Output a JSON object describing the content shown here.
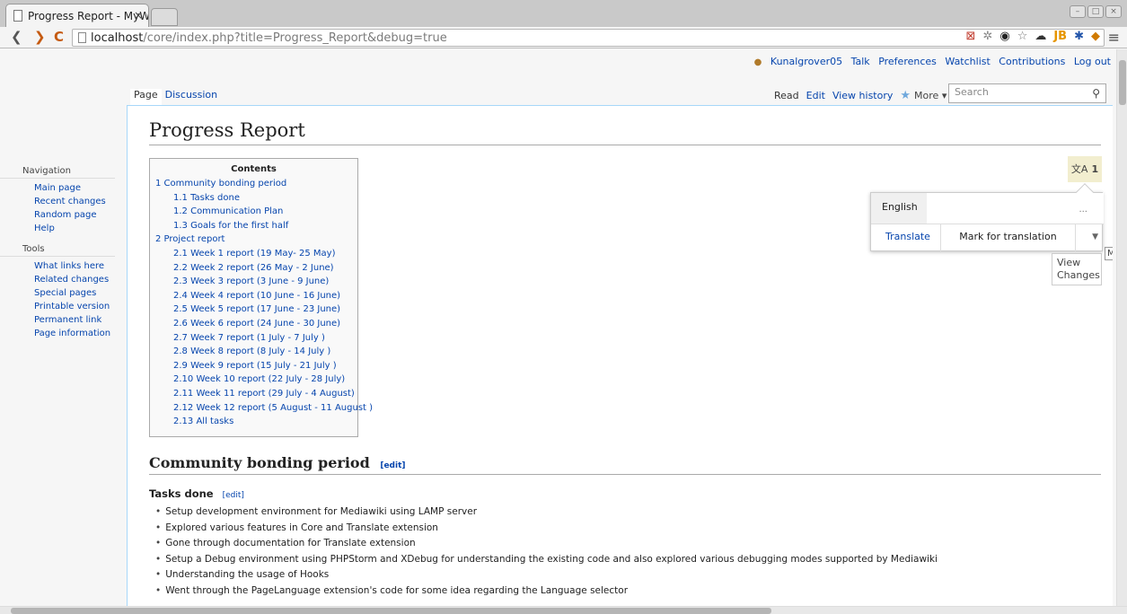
{
  "browser": {
    "tab_title": "Progress Report - MyW",
    "tab_close": "×",
    "url_host": "localhost",
    "url_path": "/core/index.php?title=Progress_Report&debug=true",
    "back": "❮",
    "forward": "❯",
    "reload": "C",
    "menu": "≡"
  },
  "personal": {
    "username": "Kunalgrover05",
    "links": [
      "Talk",
      "Preferences",
      "Watchlist",
      "Contributions",
      "Log out"
    ]
  },
  "tabs": {
    "left": [
      "Page",
      "Discussion"
    ],
    "right": [
      "Read",
      "Edit",
      "View history"
    ],
    "more": "More ▾",
    "search_placeholder": "Search"
  },
  "sidebar": {
    "navigation_heading": "Navigation",
    "navigation": [
      "Main page",
      "Recent changes",
      "Random page",
      "Help"
    ],
    "tools_heading": "Tools",
    "tools": [
      "What links here",
      "Related changes",
      "Special pages",
      "Printable version",
      "Permanent link",
      "Page information"
    ]
  },
  "page_title": "Progress Report",
  "toc": {
    "title": "Contents",
    "items": [
      {
        "text": "1 Community bonding period",
        "level": 1
      },
      {
        "text": "1.1 Tasks done",
        "level": 2
      },
      {
        "text": "1.2 Communication Plan",
        "level": 2
      },
      {
        "text": "1.3 Goals for the first half",
        "level": 2
      },
      {
        "text": "2 Project report",
        "level": 1
      },
      {
        "text": "2.1 Week 1 report (19 May- 25 May)",
        "level": 2
      },
      {
        "text": "2.2 Week 2 report (26 May - 2 June)",
        "level": 2
      },
      {
        "text": "2.3 Week 3 report (3 June - 9 June)",
        "level": 2
      },
      {
        "text": "2.4 Week 4 report (10 June - 16 June)",
        "level": 2
      },
      {
        "text": "2.5 Week 5 report (17 June - 23 June)",
        "level": 2
      },
      {
        "text": "2.6 Week 6 report (24 June - 30 June)",
        "level": 2
      },
      {
        "text": "2.7 Week 7 report (1 July - 7 July )",
        "level": 2
      },
      {
        "text": "2.8 Week 8 report (8 July - 14 July )",
        "level": 2
      },
      {
        "text": "2.9 Week 9 report (15 July - 21 July )",
        "level": 2
      },
      {
        "text": "2.10 Week 10 report (22 July - 28 July)",
        "level": 2
      },
      {
        "text": "2.11 Week 11 report (29 July - 4 August)",
        "level": 2
      },
      {
        "text": "2.12 Week 12 report (5 August - 11 August )",
        "level": 2
      },
      {
        "text": "2.13 All tasks",
        "level": 2
      }
    ]
  },
  "translate": {
    "badge_glyph": "文A",
    "badge_count": "1",
    "language": "English",
    "dots": "...",
    "translate_link": "Translate",
    "mark_label": "Mark for translation",
    "tooltip_view": "View Changes",
    "tooltip_more": "More"
  },
  "section": {
    "heading": "Community bonding period",
    "edit": "[edit]",
    "subheading": "Tasks done",
    "sub_edit": "[edit]",
    "bullets": [
      "Setup development environment for Mediawiki using LAMP server",
      "Explored various features in Core and Translate extension",
      "Gone through documentation for Translate extension",
      "Setup a Debug environment using PHPStorm and XDebug for understanding the existing code and also explored various debugging modes supported by Mediawiki",
      "Understanding the usage of Hooks",
      "Went through the PageLanguage extension's code for some idea regarding the Language selector"
    ]
  }
}
